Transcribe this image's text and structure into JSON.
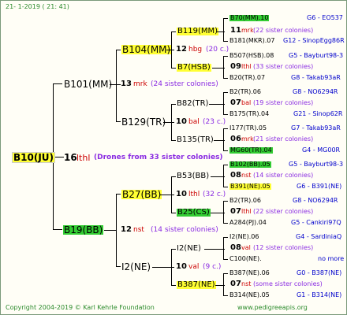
{
  "header": "21-   1-2019  ( 21:  41)",
  "footer_left": "Copyright 2004-2019 © Karl Kehrle Foundation",
  "footer_right": "www.pedigreeapis.org",
  "root": {
    "id": "B10(JU)",
    "num": "16",
    "val": "lthl",
    "sister_note": "(Drones from 33 sister colonies)"
  },
  "l1": [
    {
      "id": "B101(MM)",
      "num": "13",
      "val": "mrk",
      "note": "(24 sister colonies)"
    },
    {
      "id": "B19(BB)",
      "num": "12",
      "val": "nst",
      "note": "(14 sister colonies)"
    }
  ],
  "l2": [
    {
      "id": "B104(MM)",
      "num": "12",
      "val": "hbg",
      "note": "(20 c.)"
    },
    {
      "id": "B129(TR)",
      "num": "10",
      "val": "bal",
      "note": "(23 c.)"
    },
    {
      "id": "B27(BB)",
      "num": "10",
      "val": "lthl",
      "note": "(32 c.)"
    },
    {
      "id": "I2(NE)",
      "num": "10",
      "val": "val",
      "note": "(9 c.)"
    }
  ],
  "l3": [
    {
      "id": "B119(MM)",
      "num": "11",
      "val": "mrk",
      "note": "(22 sister colonies)"
    },
    {
      "id": "B7(HSB)",
      "num": "09",
      "val": "lthl",
      "note": "(33 sister colonies)"
    },
    {
      "id": "B82(TR)",
      "num": "07",
      "val": "bal",
      "note": "(19 sister colonies)"
    },
    {
      "id": "B135(TR)",
      "num": "06",
      "val": "mrk",
      "note": "(21 sister colonies)"
    },
    {
      "id": "B53(BB)",
      "num": "08",
      "val": "nst",
      "note": "(14 sister colonies)"
    },
    {
      "id": "B25(CS)",
      "num": "07",
      "val": "lthl",
      "note": "(22 sister colonies)"
    },
    {
      "id": "I2(NE)",
      "num": "08",
      "val": "val",
      "note": "(12 sister colonies)"
    },
    {
      "id": "B387(NE)",
      "num": "07",
      "val": "nst",
      "note": "(some sister colonies)"
    }
  ],
  "l4": [
    {
      "id": "B70(MM).10",
      "right": "G6 - EO537"
    },
    {
      "id": "B181(MKR).07",
      "right": "G12 - SinopEgg86R"
    },
    {
      "id": "B507(HSB).08",
      "right": "G5 - Bayburt98-3"
    },
    {
      "id": "B20(TR).07",
      "right": "G8 - Takab93aR"
    },
    {
      "id": "B2(TR).06",
      "right": "G8 - NO6294R"
    },
    {
      "id": "B175(TR).04",
      "right": "G21 - Sinop62R"
    },
    {
      "id": "I177(TR).05",
      "right": "G7 - Takab93aR"
    },
    {
      "id": "MG60(TR).04",
      "right": "G4 - MG00R"
    },
    {
      "id": "B102(BB).05",
      "right": "G5 - Bayburt98-3"
    },
    {
      "id": "B391(NE).05",
      "right": "G6 - B391(NE)"
    },
    {
      "id": "B2(TR).06",
      "right": "G8 - NO6294R"
    },
    {
      "id": "A284(PJ).04",
      "right": "G5 - Cankiri97Q"
    },
    {
      "id": "I2(NE).06",
      "right": "G4 - SardiniaQ"
    },
    {
      "id": "C100(NE).",
      "right": "no more"
    },
    {
      "id": "B387(NE).06",
      "right": "G0 - B387(NE)"
    },
    {
      "id": "B314(NE).05",
      "right": "G1 - B314(NE)"
    }
  ]
}
